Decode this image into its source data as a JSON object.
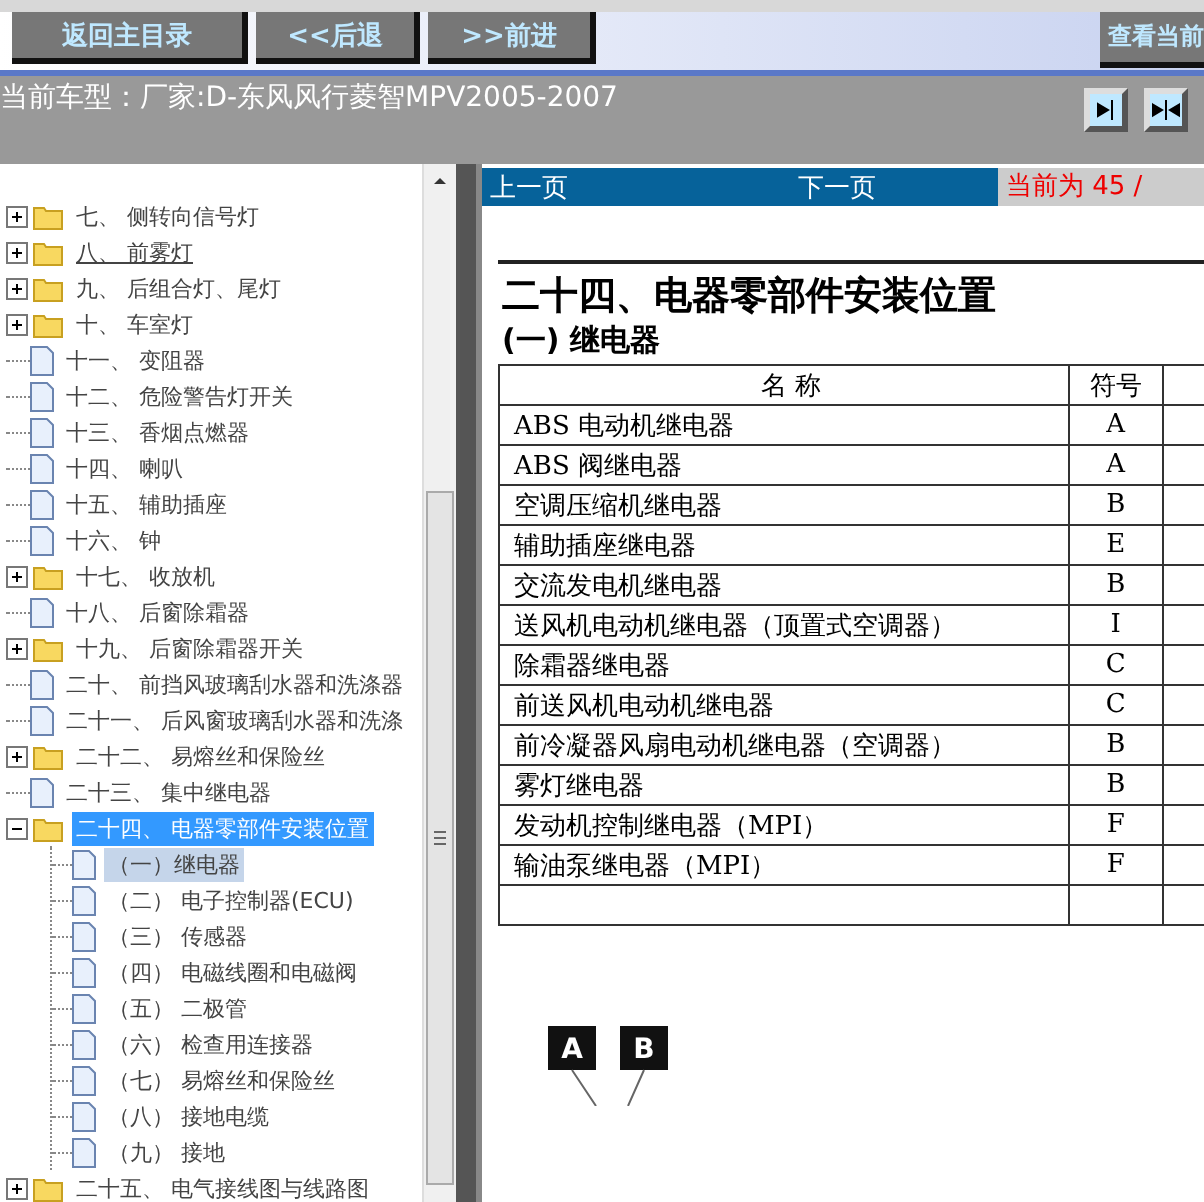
{
  "toolbar": {
    "buttons": [
      "返回主目录",
      "<<后退",
      ">>前进"
    ],
    "right_button": "查看当前"
  },
  "car_model": "当前车型：厂家:D-东风风行菱智MPV2005-2007",
  "tree": {
    "items": [
      {
        "label": "七、  侧转向信号灯",
        "kind": "folder",
        "expanded": false,
        "selected": false,
        "hovered": false
      },
      {
        "label": "八、  前雾灯",
        "kind": "folder",
        "expanded": false,
        "selected": false,
        "hovered": true
      },
      {
        "label": "九、  后组合灯、尾灯",
        "kind": "folder",
        "expanded": false,
        "selected": false,
        "hovered": false
      },
      {
        "label": "十、  车室灯",
        "kind": "folder",
        "expanded": false,
        "selected": false,
        "hovered": false
      },
      {
        "label": "十一、  变阻器",
        "kind": "page",
        "selected": false,
        "hovered": false
      },
      {
        "label": "十二、  危险警告灯开关",
        "kind": "page",
        "selected": false,
        "hovered": false
      },
      {
        "label": "十三、  香烟点燃器",
        "kind": "page",
        "selected": false,
        "hovered": false
      },
      {
        "label": "十四、  喇叭",
        "kind": "page",
        "selected": false,
        "hovered": false
      },
      {
        "label": "十五、  辅助插座",
        "kind": "page",
        "selected": false,
        "hovered": false
      },
      {
        "label": "十六、  钟",
        "kind": "page",
        "selected": false,
        "hovered": false
      },
      {
        "label": "十七、  收放机",
        "kind": "folder",
        "expanded": false,
        "selected": false,
        "hovered": false
      },
      {
        "label": "十八、  后窗除霜器",
        "kind": "page",
        "selected": false,
        "hovered": false
      },
      {
        "label": "十九、  后窗除霜器开关",
        "kind": "folder",
        "expanded": false,
        "selected": false,
        "hovered": false
      },
      {
        "label": "二十、  前挡风玻璃刮水器和洗涤器",
        "kind": "page",
        "selected": false,
        "hovered": false
      },
      {
        "label": "二十一、  后风窗玻璃刮水器和洗涤",
        "kind": "page",
        "selected": false,
        "hovered": false
      },
      {
        "label": "二十二、  易熔丝和保险丝",
        "kind": "folder",
        "expanded": false,
        "selected": false,
        "hovered": false
      },
      {
        "label": "二十三、  集中继电器",
        "kind": "page",
        "selected": false,
        "hovered": false
      },
      {
        "label": "二十四、  电器零部件安装位置",
        "kind": "folder",
        "expanded": true,
        "selected": true,
        "hovered": false,
        "children": [
          {
            "label": "（一）继电器",
            "current": true
          },
          {
            "label": "（二）  电子控制器(ECU)",
            "current": false
          },
          {
            "label": "（三）  传感器",
            "current": false
          },
          {
            "label": "（四）  电磁线圈和电磁阀",
            "current": false
          },
          {
            "label": "（五）  二极管",
            "current": false
          },
          {
            "label": "（六）  检查用连接器",
            "current": false
          },
          {
            "label": "（七）  易熔丝和保险丝",
            "current": false
          },
          {
            "label": "（八）  接地电缆",
            "current": false
          },
          {
            "label": "（九）  接地",
            "current": false
          }
        ]
      },
      {
        "label": "二十五、  电气接线图与线路图",
        "kind": "folder",
        "expanded": false,
        "selected": false,
        "hovered": false
      }
    ]
  },
  "viewer": {
    "prev": "上一页",
    "next": "下一页",
    "page_status": "当前为 45 /",
    "heading": "二十四、电器零部件安装位置",
    "subheading": "(一)  继电器",
    "table": {
      "columns": [
        "名  称",
        "符号"
      ],
      "rows": [
        {
          "name": "ABS 电动机继电器",
          "symbol": "A"
        },
        {
          "name": "ABS 阀继电器",
          "symbol": "A"
        },
        {
          "name": "空调压缩机继电器",
          "symbol": "B"
        },
        {
          "name": "辅助插座继电器",
          "symbol": "E"
        },
        {
          "name": "交流发电机继电器",
          "symbol": "B"
        },
        {
          "name": "送风机电动机继电器（顶置式空调器）",
          "symbol": "I"
        },
        {
          "name": "除霜器继电器",
          "symbol": "C"
        },
        {
          "name": "前送风机电动机继电器",
          "symbol": "C"
        },
        {
          "name": "前冷凝器风扇电动机继电器（空调器）",
          "symbol": "B"
        },
        {
          "name": "雾灯继电器",
          "symbol": "B"
        },
        {
          "name": "发动机控制继电器（MPI）",
          "symbol": "F"
        },
        {
          "name": "输油泵继电器（MPI）",
          "symbol": "F"
        }
      ]
    },
    "figure_labels": [
      "A",
      "B"
    ]
  }
}
